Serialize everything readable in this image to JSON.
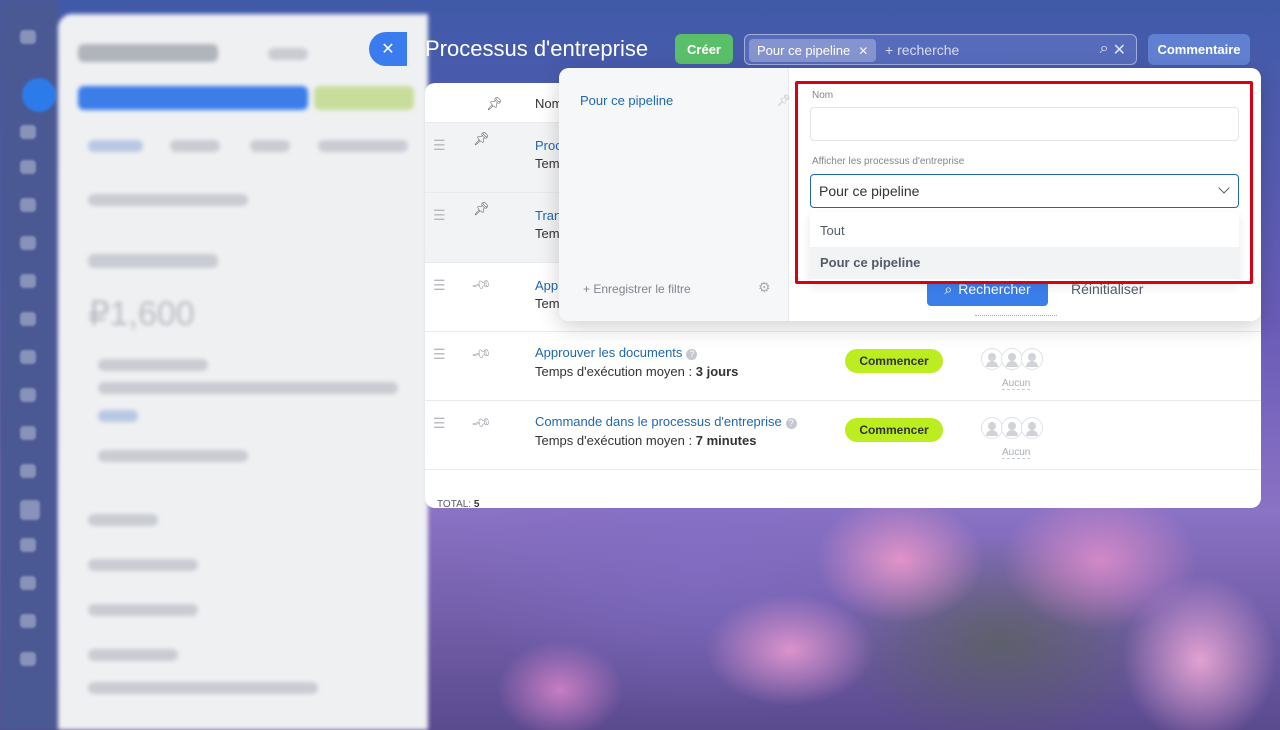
{
  "window": {
    "title": "Processus d'entreprise"
  },
  "toolbar": {
    "create_label": "Créer",
    "filter_tag": "Pour ce pipeline",
    "search_placeholder": "+ recherche",
    "comment_label": "Commentaire"
  },
  "grid": {
    "header_name": "Nom",
    "rows": [
      {
        "name_visible": "Proc",
        "sub_visible": "Tem"
      },
      {
        "name_visible": "Tran",
        "sub_visible": "Tem"
      },
      {
        "name_visible": "Appr",
        "sub_visible": "Tem"
      },
      {
        "name": "Approuver les documents",
        "sub_prefix": "Temps d'exécution moyen : ",
        "sub_value": "3 jours",
        "start_label": "Commencer",
        "none_label": "Aucun"
      },
      {
        "name": "Commande dans le processus d'entreprise",
        "sub_prefix": "Temps d'exécution moyen : ",
        "sub_value": "7 minutes",
        "start_label": "Commencer",
        "none_label": "Aucun"
      }
    ],
    "total_label": "TOTAL:",
    "total_value": "5"
  },
  "filter_popup": {
    "preset": "Pour ce pipeline",
    "save_filter": "Enregistrer le filtre",
    "name_label": "Nom",
    "name_value": "",
    "show_label": "Afficher les processus d'entreprise",
    "show_value": "Pour ce pipeline",
    "options": [
      "Tout",
      "Pour ce pipeline"
    ],
    "search_button": "Rechercher",
    "reset_button": "Réinitialiser"
  },
  "colors": {
    "accent": "#3b7de9",
    "create": "#5bbf6a",
    "start": "#bbed21",
    "highlight": "#d9000f"
  }
}
